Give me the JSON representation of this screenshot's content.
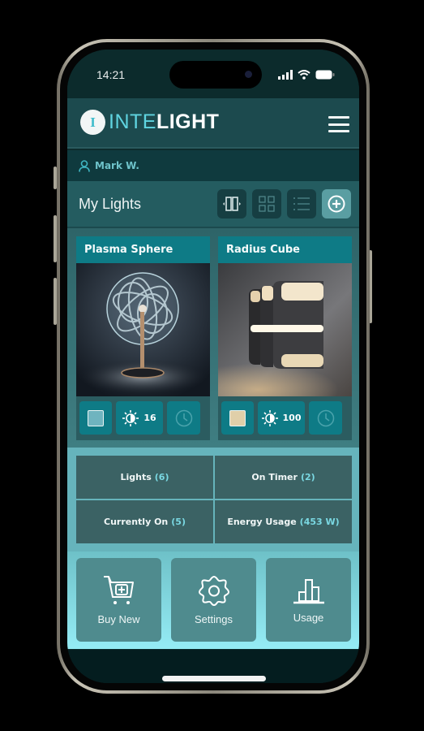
{
  "status_bar": {
    "time": "14:21",
    "icons": [
      "signal-icon",
      "wifi-icon",
      "battery-icon"
    ]
  },
  "header": {
    "logo_badge": "I",
    "logo_part1": "INTE",
    "logo_part2": "LIGHT",
    "menu_icon": "hamburger-menu-icon"
  },
  "user": {
    "name": "Mark W.",
    "icon": "user-icon"
  },
  "lights_section": {
    "title": "My Lights",
    "view_buttons": [
      {
        "name": "carousel-view",
        "icon": "carousel-icon"
      },
      {
        "name": "grid-view",
        "icon": "grid-icon"
      },
      {
        "name": "list-view",
        "icon": "list-icon"
      },
      {
        "name": "add-light",
        "icon": "plus-circle-icon"
      }
    ]
  },
  "lights": [
    {
      "name": "Plasma Sphere",
      "color": "#6fb4bf",
      "brightness": "16",
      "icons": [
        "brightness-icon",
        "clock-icon"
      ]
    },
    {
      "name": "Radius Cube",
      "color": "#e0cfa9",
      "brightness": "100",
      "icons": [
        "brightness-icon",
        "clock-icon"
      ]
    }
  ],
  "stats": [
    {
      "label": "Lights",
      "value": "(6)"
    },
    {
      "label": "On Timer",
      "value": "(2)"
    },
    {
      "label": "Currently On",
      "value": "(5)"
    },
    {
      "label": "Energy Usage",
      "value": "(453 W)"
    }
  ],
  "actions": [
    {
      "label": "Buy New",
      "icon": "cart-plus-icon"
    },
    {
      "label": "Settings",
      "icon": "gear-icon"
    },
    {
      "label": "Usage",
      "icon": "bar-chart-icon"
    }
  ],
  "colors": {
    "accent": "#0e7b86",
    "header": "#1c4a4e",
    "logo_cyan": "#5fd4e0",
    "stat_value": "#7ad8e2"
  }
}
